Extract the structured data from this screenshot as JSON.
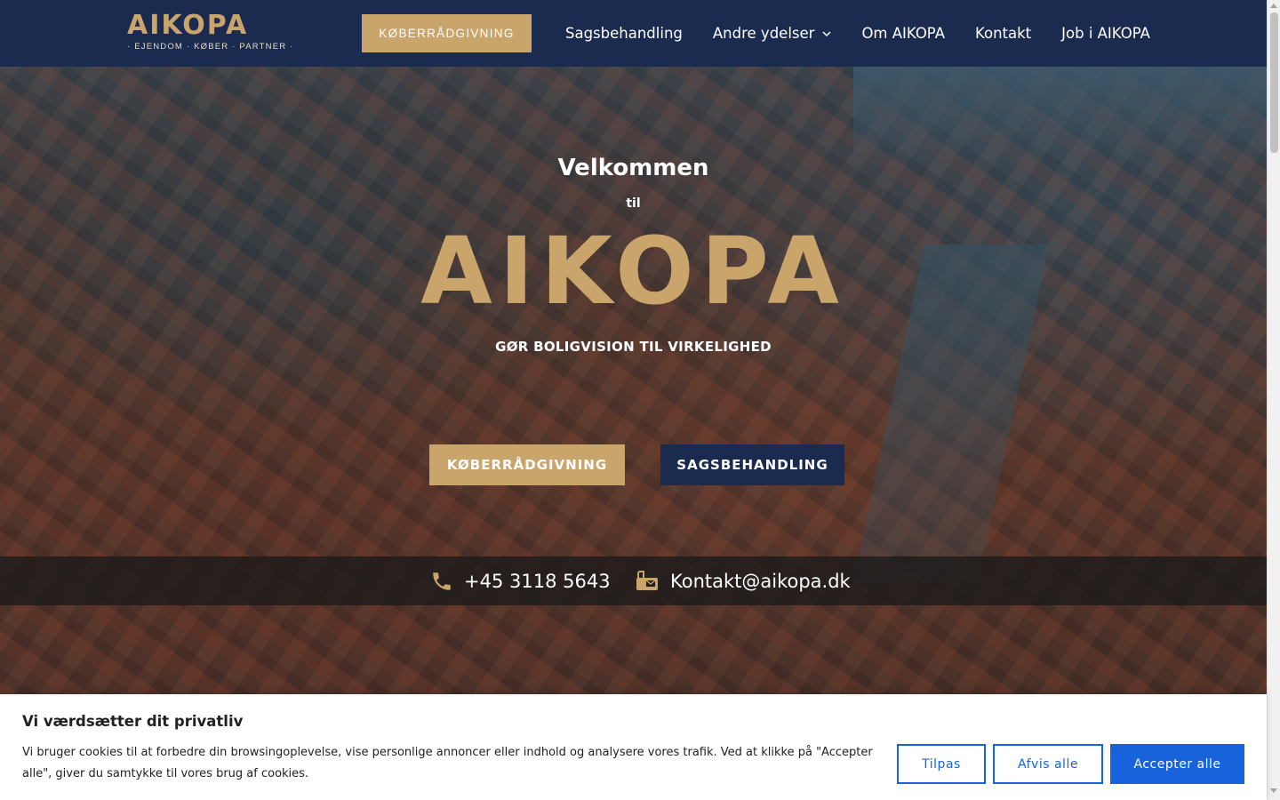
{
  "header": {
    "logo": {
      "main": "AIKOPA",
      "sub": "· EJENDOM · KØBER · PARTNER ·"
    },
    "cta_label": "KØBERRÅDGIVNING",
    "nav": [
      {
        "label": "Sagsbehandling"
      },
      {
        "label": "Andre ydelser"
      },
      {
        "label": "Om AIKOPA"
      },
      {
        "label": "Kontakt"
      },
      {
        "label": "Job i AIKOPA"
      }
    ]
  },
  "hero": {
    "welcome": "Velkommen",
    "til": "til",
    "brand": "AIKOPA",
    "tagline": "GØR BOLIGVISION TIL VIRKELIGHED",
    "buttons": {
      "primary": "KØBERRÅDGIVNING",
      "secondary": "SAGSBEHANDLING"
    },
    "contact": {
      "phone": "+45 3118 5643",
      "email": "Kontakt@aikopa.dk",
      "phone_icon": "phone-icon",
      "email_icon": "mail-box-icon"
    }
  },
  "cookie": {
    "title": "Vi værdsætter dit privatliv",
    "text": "Vi bruger cookies til at forbedre din browsingoplevelse, vise personlige annoncer eller indhold og analysere vores trafik. Ved at klikke på \"Accepter alle\", giver du samtykke til vores brug af cookies.",
    "customize": "Tilpas",
    "reject": "Afvis alle",
    "accept": "Accepter alle"
  },
  "colors": {
    "navy": "#1a2b4f",
    "gold": "#c9a56c",
    "cookie_blue": "#1863dc"
  }
}
